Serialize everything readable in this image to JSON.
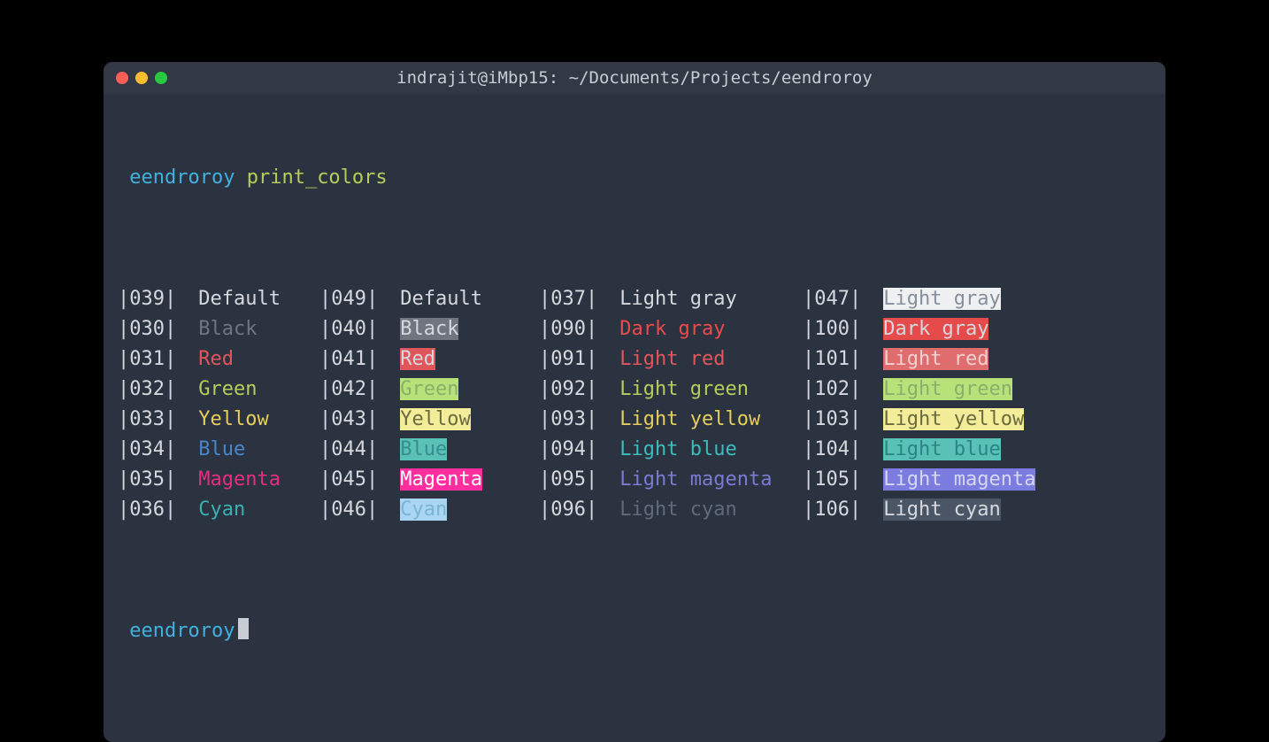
{
  "window": {
    "title": "indrajit@iMbp15: ~/Documents/Projects/eendroroy"
  },
  "prompt1": {
    "user": "eendroroy",
    "command": "print_colors"
  },
  "prompt2": {
    "user": "eendroroy"
  },
  "colors": {
    "default_fg": "#d5d8dd",
    "term_bg": "#2b3240",
    "palette": {
      "black": "#707580",
      "red": "#e0565a",
      "green": "#b7cd5b",
      "yellow": "#e7cd5b",
      "blue": "#4987c9",
      "magenta": "#e72d82",
      "cyan": "#3ab2b2",
      "light_gray": "#d5d8dd",
      "dark_gray": "#eb4b4b",
      "light_red": "#e0565a",
      "light_green": "#b7cd5b",
      "light_yellow": "#e7cd5b",
      "light_blue": "#3cbdbd",
      "light_magenta": "#7b7bd4",
      "light_cyan": "#5f6a7a",
      "white": "#ffffff",
      "bg_black": "#707580",
      "bg_red": "#e0565a",
      "bg_green": "#b7e27a",
      "bg_yellow": "#f3ec99",
      "bg_blue": "#5ac1b7",
      "bg_magenta": "#ff2e9e",
      "bg_cyan": "#a7d5f2",
      "bg_lightgray": "#eef0f2",
      "bg_darkgray": "#e64b4b",
      "bg_lightred": "#e06d6d",
      "bg_lightgreen": "#b7e27a",
      "bg_lightyellow": "#f3ec99",
      "bg_lightblue": "#5ac1b7",
      "bg_lightmagenta": "#7b7be0",
      "bg_lightcyan": "#4a5666"
    }
  },
  "rows": [
    {
      "a_code": "039",
      "a_name": "Default",
      "a_fg": "#d5d8dd",
      "a_bg": "",
      "b_code": "049",
      "b_name": "Default",
      "b_fg": "#d5d8dd",
      "b_bg": "",
      "c_code": "037",
      "c_name": "Light gray",
      "c_fg": "#d5d8dd",
      "c_bg": "",
      "d_code": "047",
      "d_name": "Light gray",
      "d_fg": "#878e9c",
      "d_bg": "#eef0f2"
    },
    {
      "a_code": "030",
      "a_name": "Black",
      "a_fg": "#707580",
      "a_bg": "",
      "b_code": "040",
      "b_name": "Black",
      "b_fg": "#d5d8dd",
      "b_bg": "#707580",
      "c_code": "090",
      "c_name": "Dark gray",
      "c_fg": "#eb4b4b",
      "c_bg": "",
      "d_code": "100",
      "d_name": "Dark gray",
      "d_fg": "#d5d8dd",
      "d_bg": "#e64b4b"
    },
    {
      "a_code": "031",
      "a_name": "Red",
      "a_fg": "#e0565a",
      "a_bg": "",
      "b_code": "041",
      "b_name": "Red",
      "b_fg": "#d5d8dd",
      "b_bg": "#e0565a",
      "c_code": "091",
      "c_name": "Light red",
      "c_fg": "#e0565a",
      "c_bg": "",
      "d_code": "101",
      "d_name": "Light red",
      "d_fg": "#f2d0d0",
      "d_bg": "#e06d6d"
    },
    {
      "a_code": "032",
      "a_name": "Green",
      "a_fg": "#b7cd5b",
      "a_bg": "",
      "b_code": "042",
      "b_name": "Green",
      "b_fg": "#88b06a",
      "b_bg": "#b7e27a",
      "c_code": "092",
      "c_name": "Light green",
      "c_fg": "#b7cd5b",
      "c_bg": "",
      "d_code": "102",
      "d_name": "Light green",
      "d_fg": "#88b06a",
      "d_bg": "#b7e27a"
    },
    {
      "a_code": "033",
      "a_name": "Yellow",
      "a_fg": "#e7cd5b",
      "a_bg": "",
      "b_code": "043",
      "b_name": "Yellow",
      "b_fg": "#6b6b3e",
      "b_bg": "#f3ec99",
      "c_code": "093",
      "c_name": "Light yellow",
      "c_fg": "#e7cd5b",
      "c_bg": "",
      "d_code": "103",
      "d_name": "Light yellow",
      "d_fg": "#6b6b3e",
      "d_bg": "#f3ec99"
    },
    {
      "a_code": "034",
      "a_name": "Blue",
      "a_fg": "#4987c9",
      "a_bg": "",
      "b_code": "044",
      "b_name": "Blue",
      "b_fg": "#3a8d8d",
      "b_bg": "#5ac1b7",
      "c_code": "094",
      "c_name": "Light blue",
      "c_fg": "#3cbdbd",
      "c_bg": "",
      "d_code": "104",
      "d_name": "Light blue",
      "d_fg": "#2a8585",
      "d_bg": "#5ac1b7"
    },
    {
      "a_code": "035",
      "a_name": "Magenta",
      "a_fg": "#e72d82",
      "a_bg": "",
      "b_code": "045",
      "b_name": "Magenta",
      "b_fg": "#ffffff",
      "b_bg": "#ff2e9e",
      "c_code": "095",
      "c_name": "Light magenta",
      "c_fg": "#7b7bd4",
      "c_bg": "",
      "d_code": "105",
      "d_name": "Light magenta",
      "d_fg": "#d5d8f0",
      "d_bg": "#7b7be0"
    },
    {
      "a_code": "036",
      "a_name": "Cyan",
      "a_fg": "#3ab2b2",
      "a_bg": "",
      "b_code": "046",
      "b_name": "Cyan",
      "b_fg": "#7cb4d6",
      "b_bg": "#a7d5f2",
      "c_code": "096",
      "c_name": "Light cyan",
      "c_fg": "#5f6a7a",
      "c_bg": "",
      "d_code": "106",
      "d_name": "Light cyan",
      "d_fg": "#d5d8dd",
      "d_bg": "#4a5666"
    }
  ]
}
